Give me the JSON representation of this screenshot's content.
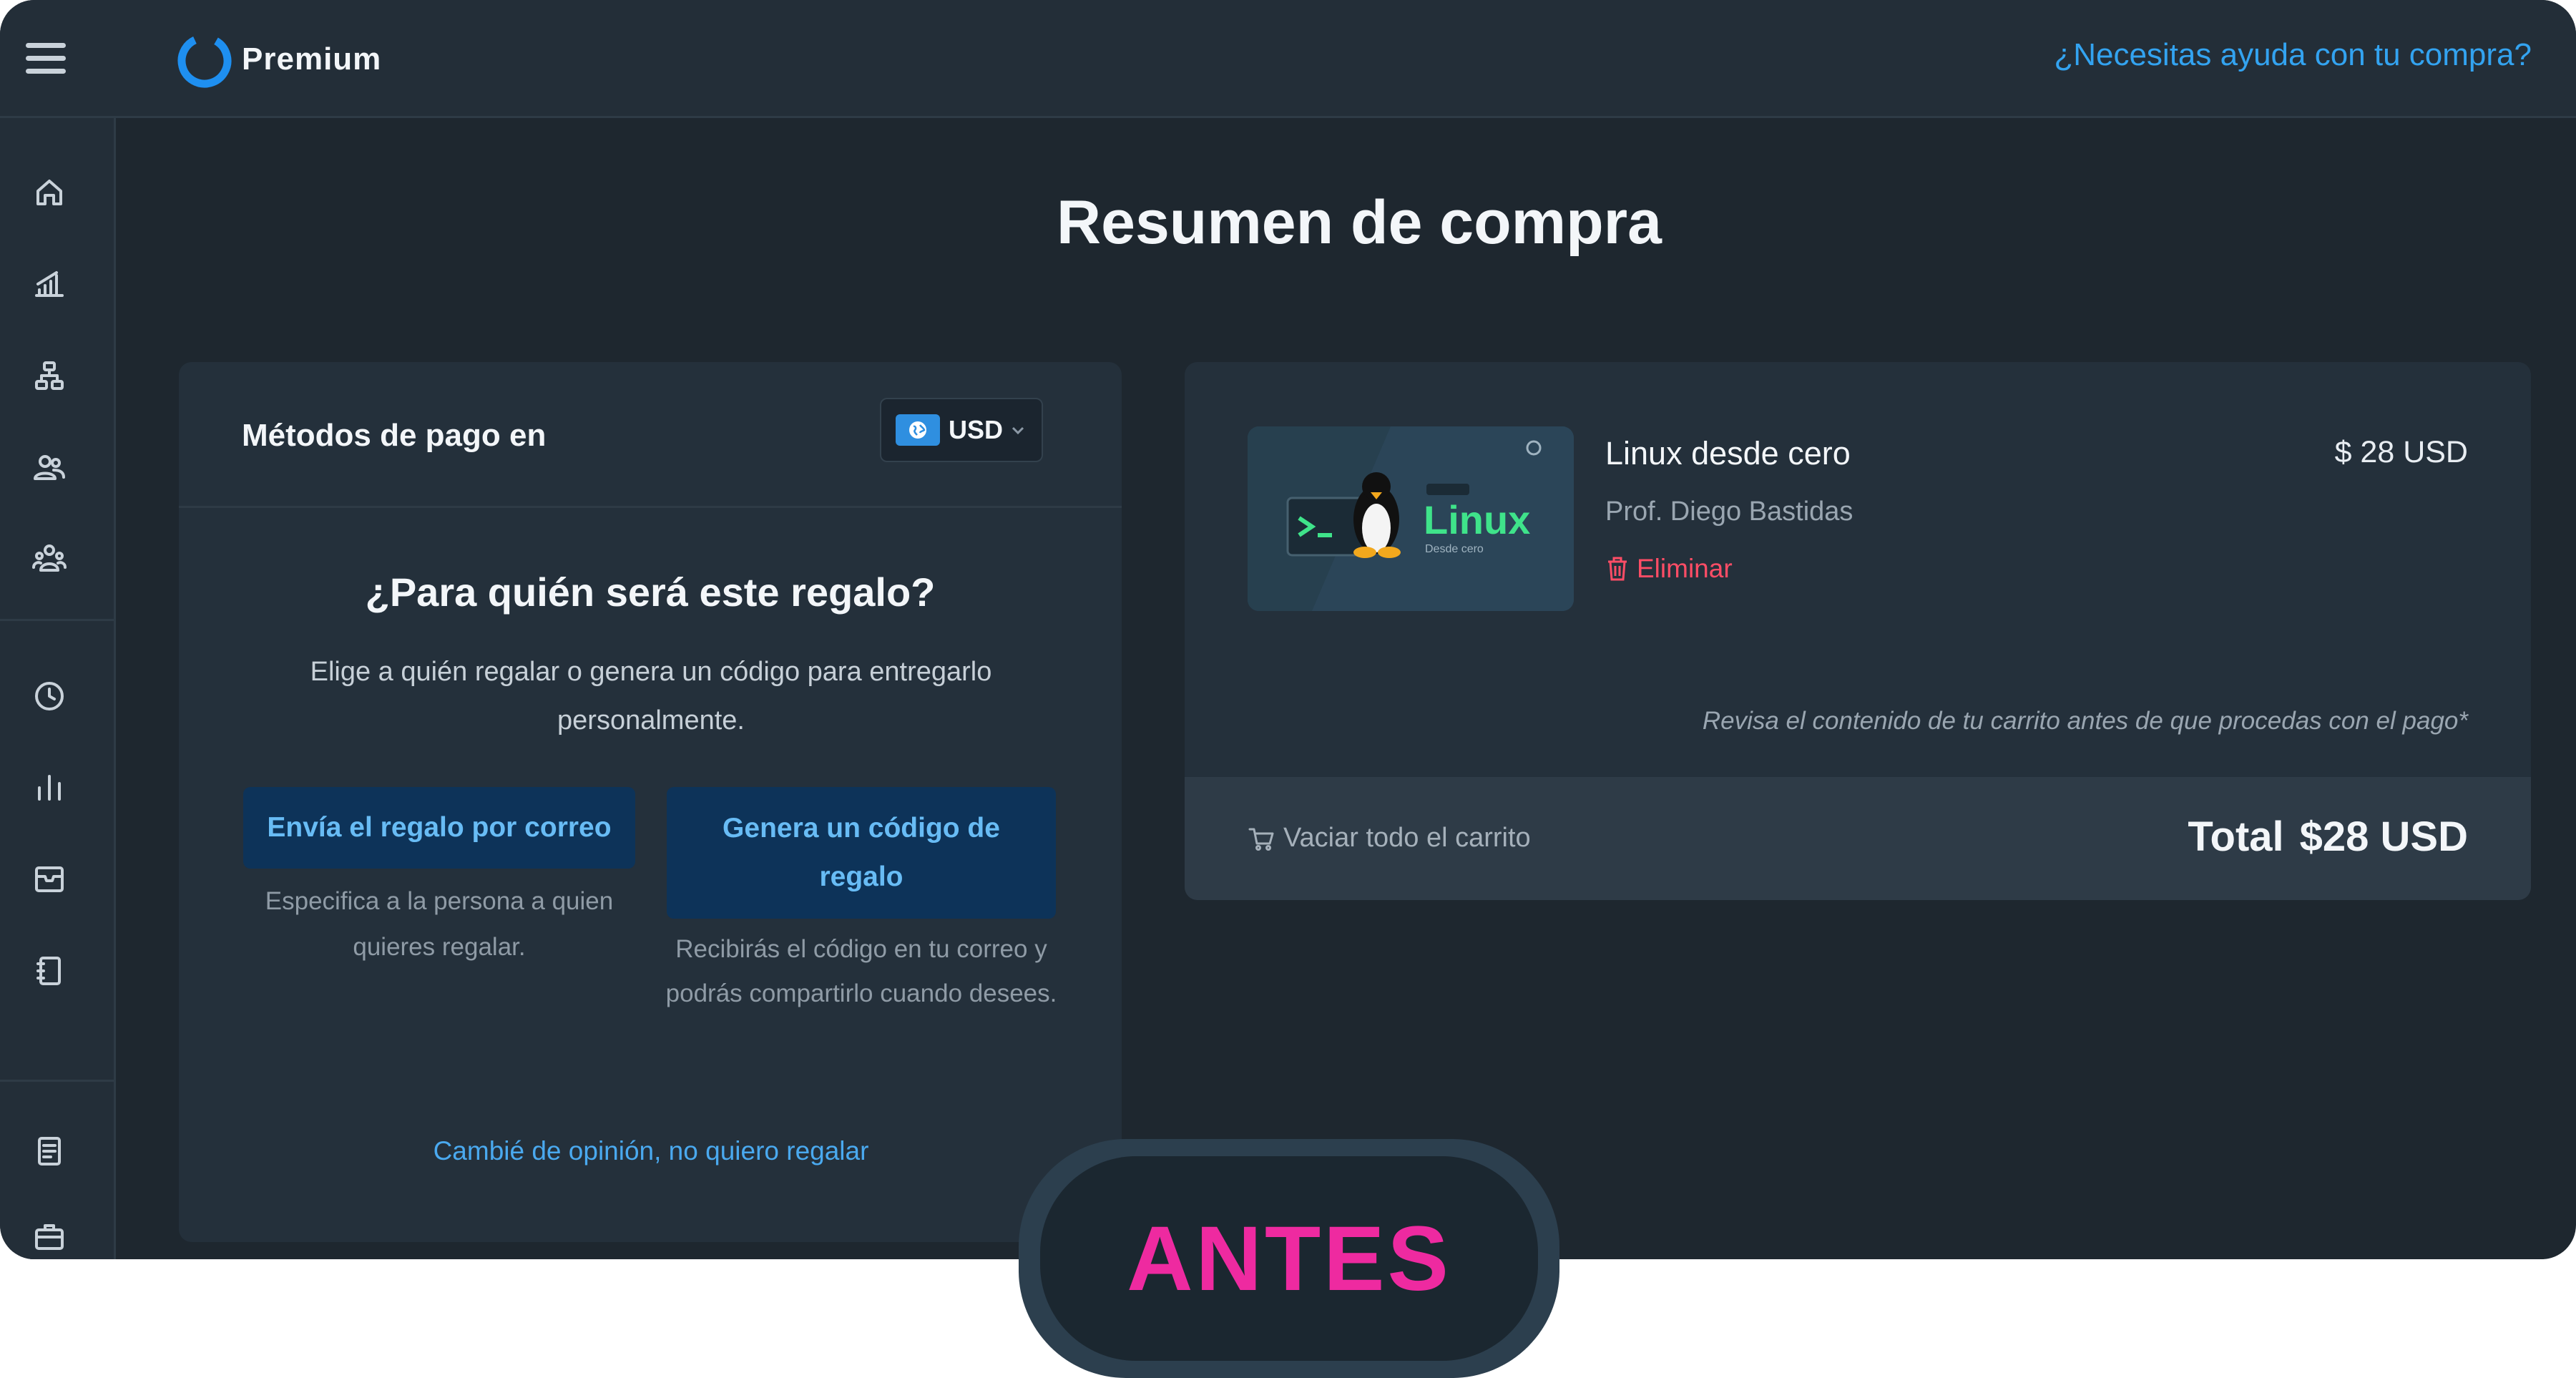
{
  "header": {
    "brand": "Premium",
    "help_link": "¿Necesitas ayuda con tu compra?"
  },
  "sidebar": {
    "icons": [
      "home-icon",
      "stats-icon",
      "org-chart-icon",
      "users-icon",
      "group-icon",
      "clock-icon",
      "bar-chart-icon",
      "inbox-icon",
      "notebook-icon",
      "document-icon",
      "briefcase-icon"
    ]
  },
  "page": {
    "title": "Resumen de compra"
  },
  "payment": {
    "methods_label": "Métodos de pago en",
    "currency": "USD"
  },
  "gift": {
    "question": "¿Para quién será este regalo?",
    "description": "Elige a quién regalar o genera un código para entregarlo personalmente.",
    "email_button": "Envía el regalo por correo",
    "email_subtext": "Especifica a la persona a quien quieres regalar.",
    "code_button": "Genera un código de regalo",
    "code_subtext": "Recibirás el código en tu correo y podrás compartirlo cuando desees.",
    "changed_mind_link": "Cambié de opinión, no quiero regalar"
  },
  "cart": {
    "item": {
      "title": "Linux desde cero",
      "professor": "Prof. Diego Bastidas",
      "price": "$ 28 USD",
      "remove_label": "Eliminar",
      "thumbnail_text": "Linux",
      "thumbnail_subtext": "Desde cero"
    },
    "review_note": "Revisa el contenido de tu carrito antes de que procedas con el pago*",
    "empty_cart_label": "Vaciar todo el carrito",
    "total_label": "Total",
    "total_value": "$28 USD"
  },
  "badge": {
    "label": "ANTES"
  },
  "colors": {
    "accent_blue": "#33a3f0",
    "danger": "#ff4d66",
    "badge_pink": "#ee2aa0",
    "background": "#1e272f"
  }
}
